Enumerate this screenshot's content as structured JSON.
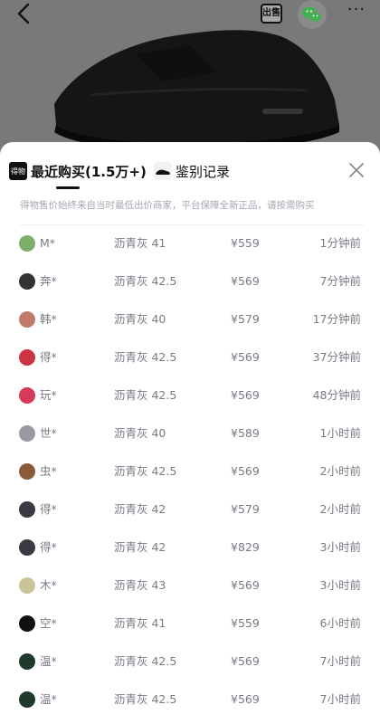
{
  "header": {
    "back_icon": "chevron-left-icon",
    "sell_label": "出售",
    "wechat_icon": "wechat-icon",
    "more_label": "···"
  },
  "sheet": {
    "tabs": [
      {
        "label": "最近购买(1.5万+)",
        "logo_text": "得物",
        "active": true
      },
      {
        "label": "鉴别记录",
        "icon": "shoe-icon",
        "active": false
      }
    ],
    "close_icon": "close-icon",
    "notice": "得物售价始终来自当时最低出价商家，平台保障全新正品，请按需购买"
  },
  "colors": {
    "sheet_bg": "#ffffff",
    "text_primary": "#111111",
    "text_secondary": "#7a7a85",
    "notice": "#a6a6b0"
  },
  "records": [
    {
      "name": "M*",
      "size": "沥青灰 41",
      "price": "¥559",
      "time": "1分钟前",
      "avatar_color": "#7fae6a"
    },
    {
      "name": "奔*",
      "size": "沥青灰 42.5",
      "price": "¥569",
      "time": "7分钟前",
      "avatar_color": "#333333"
    },
    {
      "name": "韩*",
      "size": "沥青灰 40",
      "price": "¥579",
      "time": "17分钟前",
      "avatar_color": "#c07a6a"
    },
    {
      "name": "得*",
      "size": "沥青灰 42.5",
      "price": "¥569",
      "time": "37分钟前",
      "avatar_color": "#cc3344"
    },
    {
      "name": "玩*",
      "size": "沥青灰 42.5",
      "price": "¥569",
      "time": "48分钟前",
      "avatar_color": "#d6395a"
    },
    {
      "name": "世*",
      "size": "沥青灰 40",
      "price": "¥589",
      "time": "1小时前",
      "avatar_color": "#9a9aa2"
    },
    {
      "name": "虫*",
      "size": "沥青灰 42.5",
      "price": "¥569",
      "time": "2小时前",
      "avatar_color": "#8a5a3a"
    },
    {
      "name": "得*",
      "size": "沥青灰 42",
      "price": "¥579",
      "time": "2小时前",
      "avatar_color": "#3a3a44"
    },
    {
      "name": "得*",
      "size": "沥青灰 42",
      "price": "¥829",
      "time": "3小时前",
      "avatar_color": "#3a3a44"
    },
    {
      "name": "木*",
      "size": "沥青灰 43",
      "price": "¥569",
      "time": "3小时前",
      "avatar_color": "#c9c49a"
    },
    {
      "name": "空*",
      "size": "沥青灰 41",
      "price": "¥559",
      "time": "6小时前",
      "avatar_color": "#111111"
    },
    {
      "name": "温*",
      "size": "沥青灰 42.5",
      "price": "¥569",
      "time": "7小时前",
      "avatar_color": "#1f3a2a"
    },
    {
      "name": "温*",
      "size": "沥青灰 42.5",
      "price": "¥569",
      "time": "7小时前",
      "avatar_color": "#1f3a2a"
    }
  ]
}
